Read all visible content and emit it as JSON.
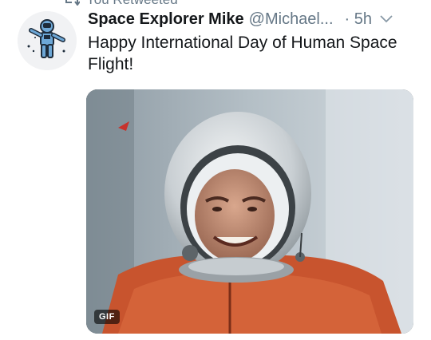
{
  "retweet": {
    "label": "You Retweeted",
    "icon": "retweet-icon"
  },
  "tweet": {
    "author_name": "Space Explorer Mike",
    "handle": "@Michael...",
    "time": "· 5h",
    "text": "Happy International Day of Human Space Flight!",
    "media": {
      "badge": "GIF",
      "icon": "astronaut-photo"
    },
    "avatar_icon": "astronaut-icon",
    "menu_icon": "chevron-down-icon"
  },
  "colors": {
    "text_primary": "#14171a",
    "text_secondary": "#657786",
    "suit_orange": "#c8542e"
  }
}
